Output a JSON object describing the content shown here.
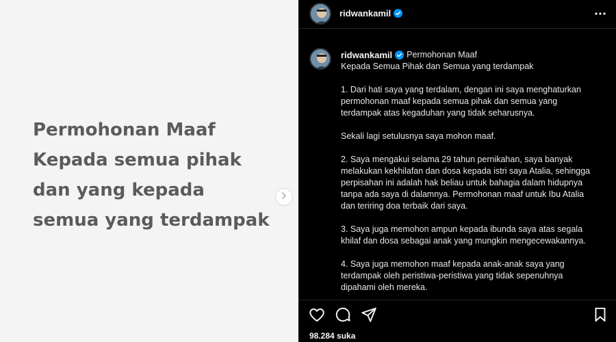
{
  "media": {
    "text": "Permohonan Maaf\nKepada semua pihak\ndan yang kepada\nsemua yang terdampak"
  },
  "post": {
    "username": "ridwankamil",
    "caption_title": "Permohonan Maaf",
    "caption_subtitle": "Kepada Semua Pihak dan Semua yang terdampak",
    "paragraphs": [
      "1. Dari hati saya yang terdalam, dengan ini saya menghaturkan\npermohonan maaf kepada semua pihak dan semua yang\nterdampak atas kegaduhan yang tidak seharusnya.",
      "Sekali lagi setulusnya saya mohon maaf.",
      "2. Saya mengakui selama 29 tahun pernikahan, saya banyak\nmelakukan kekhilafan dan dosa kepada istri saya Atalia, sehingga\nperpisahan ini adalah hak beliau untuk bahagia dalam hidupnya\ntanpa ada saya di dalamnya. Permohonan maaf untuk Ibu Atalia\ndan teriring doa terbaik dari saya.",
      "3. Saya juga memohon ampun kepada ibunda saya atas segala\nkhilaf dan dosa sebagai anak yang mungkin mengecewakannya.",
      "4. Saya juga memohon maaf kepada anak-anak saya yang\nterdampak oleh peristiwa-peristiwa yang tidak sepenuhnya\ndipahami oleh mereka."
    ],
    "likes": "98.284 suka"
  },
  "icons": {
    "verified": "verified-badge-icon",
    "more": "more-options-icon",
    "like": "heart-icon",
    "comment": "comment-icon",
    "share": "share-icon",
    "save": "bookmark-icon",
    "next": "chevron-right-icon"
  },
  "colors": {
    "verified": "#0095f6",
    "panel_bg": "#000000",
    "media_bg": "#f4f4f4",
    "media_text": "#5b5b5b"
  }
}
